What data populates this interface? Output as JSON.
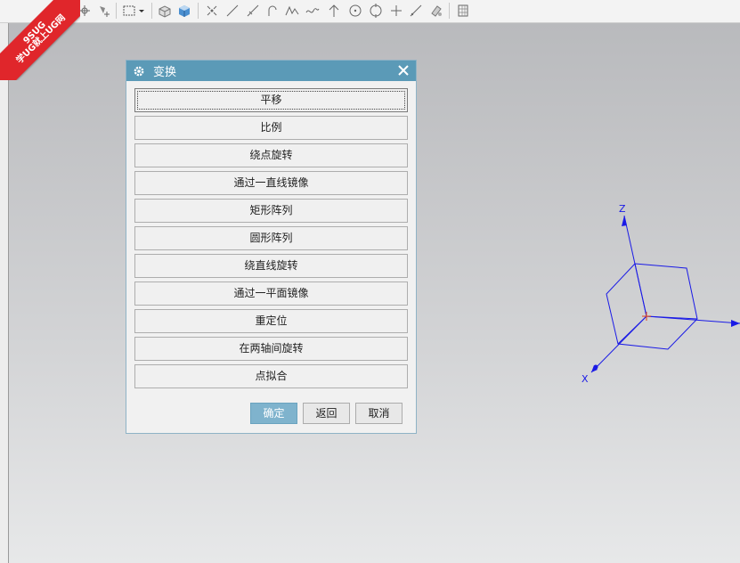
{
  "badge": {
    "brand": "9SUG",
    "slogan": "学UG就上UG网",
    "color": "#e0262b"
  },
  "toolbar": {
    "icons": [
      "snap-point-icon",
      "add-point-icon",
      "select-box-icon",
      "dropdown-arrow-icon",
      "box-solid-icon",
      "cube-shaded-icon",
      "point-set-icon",
      "line-icon",
      "line-angle-icon",
      "arc-icon",
      "spline-icon",
      "studio-spline-icon",
      "arrow-up-icon",
      "circle-center-icon",
      "circle-icon",
      "cross-point-icon",
      "diagonal-line-icon",
      "paint-icon",
      "grid-icon"
    ]
  },
  "dialog": {
    "title": "变换",
    "options": [
      "平移",
      "比例",
      "绕点旋转",
      "通过一直线镜像",
      "矩形阵列",
      "圆形阵列",
      "绕直线旋转",
      "通过一平面镜像",
      "重定位",
      "在两轴间旋转",
      "点拟合"
    ],
    "ok": "确定",
    "back": "返回",
    "cancel": "取消",
    "title_color": "#5b9ab7"
  },
  "triad": {
    "z": "Z",
    "x": "X",
    "axis_color": "#1a1ae6",
    "origin_color": "#e0401a"
  }
}
